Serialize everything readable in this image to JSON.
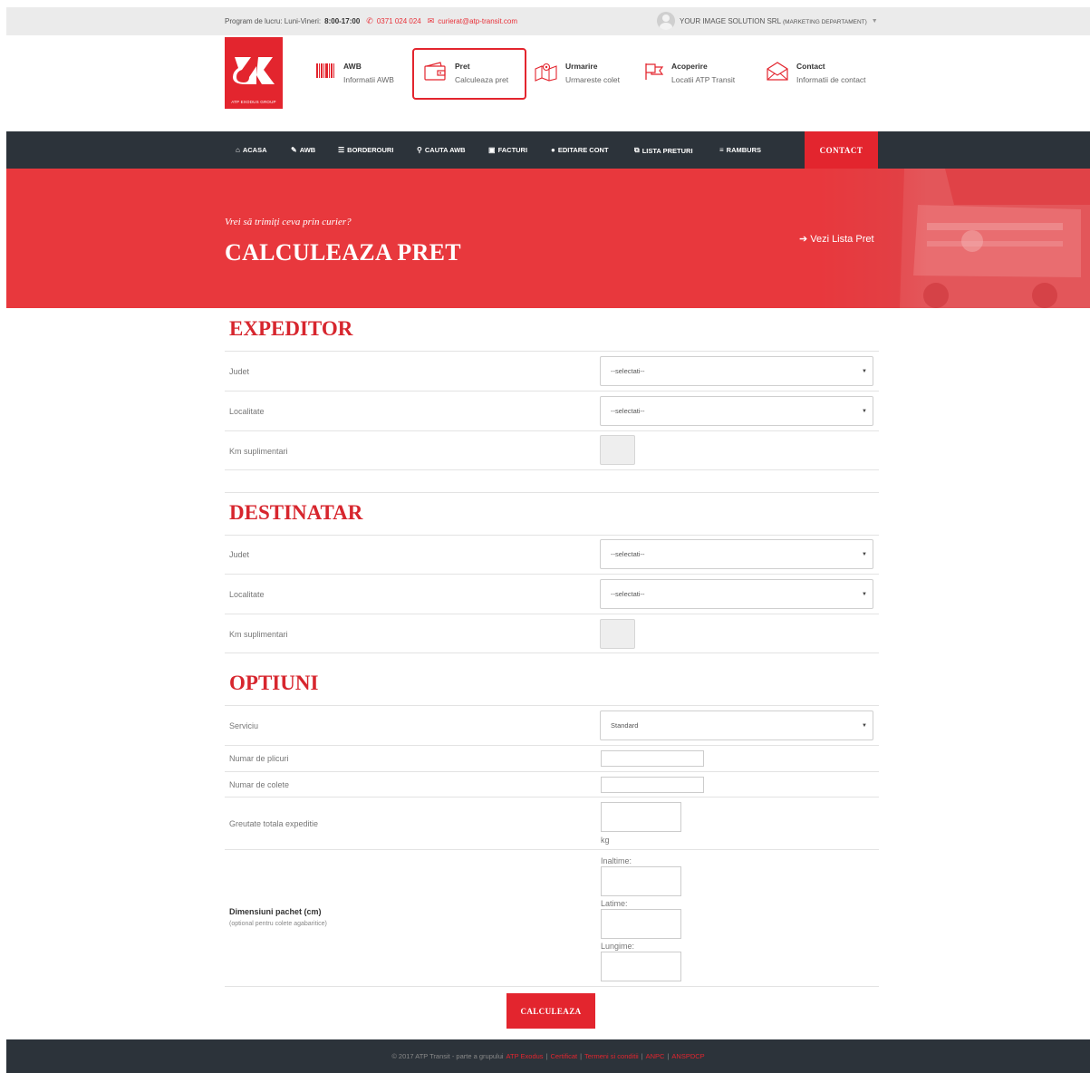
{
  "topbar": {
    "schedule_label": "Program de lucru: Luni-Vineri:",
    "schedule_hours": "8:00-17:00",
    "phone": "0371 024 024",
    "email": "curierat@atp-transit.com",
    "user_name": "YOUR IMAGE SOLUTION SRL",
    "user_dept": "(MARKETING DEPARTAMENT)"
  },
  "logo": {
    "tagline": "ATP EXODUS GROUP"
  },
  "header_items": [
    {
      "title": "AWB",
      "subtitle": "Informatii AWB",
      "icon": "barcode-icon"
    },
    {
      "title": "Pret",
      "subtitle": "Calculeaza pret",
      "icon": "wallet-icon"
    },
    {
      "title": "Urmarire",
      "subtitle": "Urmareste colet",
      "icon": "map-icon"
    },
    {
      "title": "Acoperire",
      "subtitle": "Locatii ATP Transit",
      "icon": "flag-icon"
    },
    {
      "title": "Contact",
      "subtitle": "Informatii de contact",
      "icon": "envelope-icon"
    }
  ],
  "nav": {
    "items": [
      {
        "label": "ACASA",
        "icon": "home-icon"
      },
      {
        "label": "AWB",
        "icon": "pencil-icon"
      },
      {
        "label": "BORDEROURI",
        "icon": "list-icon"
      },
      {
        "label": "CAUTA AWB",
        "icon": "search-icon"
      },
      {
        "label": "FACTURI",
        "icon": "invoice-icon"
      },
      {
        "label": "EDITARE CONT",
        "icon": "user-icon"
      },
      {
        "label": "LISTA PRETURI",
        "icon": "share-icon"
      },
      {
        "label": "RAMBURS",
        "icon": "menu-icon"
      }
    ],
    "contact": "CONTACT"
  },
  "hero": {
    "subtitle": "Vrei să trimiți ceva prin curier?",
    "title": "CALCULEAZA PRET",
    "link": "Vezi Lista Pret"
  },
  "expeditor": {
    "title": "EXPEDITOR",
    "judet_label": "Judet",
    "judet_value": "--selectati--",
    "localitate_label": "Localitate",
    "localitate_value": "--selectati--",
    "km_label": "Km suplimentari"
  },
  "destinatar": {
    "title": "DESTINATAR",
    "judet_label": "Judet",
    "judet_value": "--selectati--",
    "localitate_label": "Localitate",
    "localitate_value": "--selectati--",
    "km_label": "Km suplimentari"
  },
  "optiuni": {
    "title": "OPTIUNI",
    "serviciu_label": "Serviciu",
    "serviciu_value": "Standard",
    "plicuri_label": "Numar de plicuri",
    "colete_label": "Numar de colete",
    "greutate_label": "Greutate totala expeditie",
    "greutate_unit": "kg",
    "dimensiuni_label": "Dimensiuni pachet (cm)",
    "dimensiuni_note": "(optional pentru colete agabaritice)",
    "inaltime_label": "Inaltime:",
    "latime_label": "Latime:",
    "lungime_label": "Lungime:"
  },
  "submit_label": "CALCULEAZA",
  "footer": {
    "copyright": "© 2017 ATP Transit - parte a grupului",
    "links": [
      "ATP Exodus",
      "Certificat",
      "Termeni si conditii",
      "ANPC",
      "ANSPDCP"
    ]
  },
  "colors": {
    "accent": "#e3252e",
    "nav_bg": "#2c333a"
  }
}
